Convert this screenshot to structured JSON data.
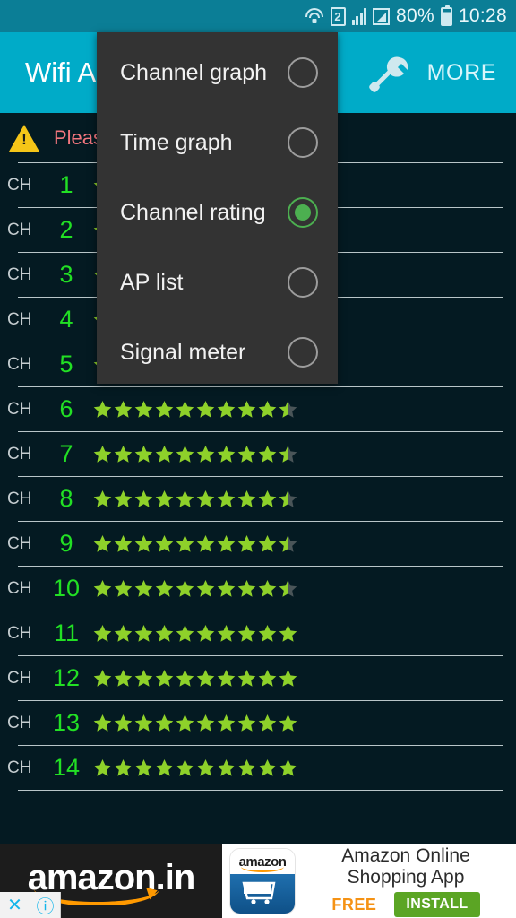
{
  "status_bar": {
    "battery_percent": "80%",
    "time": "10:28",
    "sim_label": "2",
    "icons": [
      "wifi-icon",
      "sim-2-icon",
      "signal-bars-icon",
      "signal-bars-2-icon",
      "battery-icon"
    ],
    "background_color": "#0b7e96"
  },
  "app_bar": {
    "title": "Wifi A",
    "more_label": "MORE",
    "background_color": "#00abc8",
    "icons": [
      "wrench-icon"
    ]
  },
  "menu": {
    "background_color": "#333333",
    "selected_color": "#4caf50",
    "items": [
      {
        "label": "Channel graph",
        "selected": false
      },
      {
        "label": "Time graph",
        "selected": false
      },
      {
        "label": "Channel rating",
        "selected": true
      },
      {
        "label": "AP list",
        "selected": false
      },
      {
        "label": "Signal meter",
        "selected": false
      }
    ]
  },
  "warning": {
    "text": "Pleas",
    "icon": "warning-triangle-icon",
    "icon_glyph": "!",
    "text_color": "#f2767e",
    "icon_color": "#f5c518"
  },
  "channel_list": {
    "ch_prefix": "CH",
    "max_stars": 10,
    "star_color": "#8ed12a",
    "star_empty_color": "#4a5558",
    "number_color": "#22e024",
    "rows": [
      {
        "channel": "1",
        "rating": 10
      },
      {
        "channel": "2",
        "rating": 10
      },
      {
        "channel": "3",
        "rating": 10
      },
      {
        "channel": "4",
        "rating": 10
      },
      {
        "channel": "5",
        "rating": 10
      },
      {
        "channel": "6",
        "rating": 9.5
      },
      {
        "channel": "7",
        "rating": 9.5
      },
      {
        "channel": "8",
        "rating": 9.5
      },
      {
        "channel": "9",
        "rating": 9.5
      },
      {
        "channel": "10",
        "rating": 9.5
      },
      {
        "channel": "11",
        "rating": 10
      },
      {
        "channel": "12",
        "rating": 10
      },
      {
        "channel": "13",
        "rating": 10
      },
      {
        "channel": "14",
        "rating": 10
      }
    ]
  },
  "ad": {
    "brand": "amazon",
    "brand_suffix": ".in",
    "icon_label": "amazon",
    "title": "Amazon Online Shopping App",
    "free_label": "FREE",
    "install_label": "INSTALL",
    "close_glyph": "✕",
    "info_glyph": "ⓘ",
    "install_color": "#5ba524",
    "free_color": "#f59214"
  }
}
